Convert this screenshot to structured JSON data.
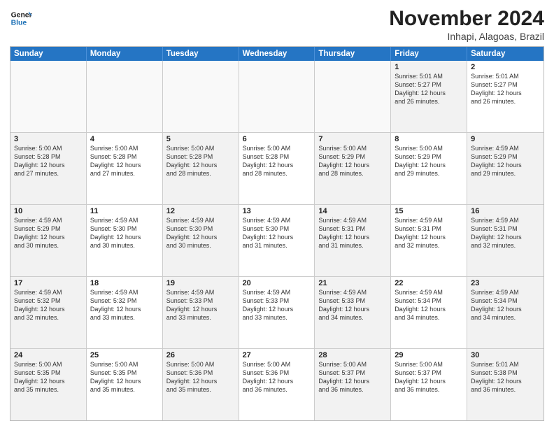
{
  "logo": {
    "text_general": "General",
    "text_blue": "Blue"
  },
  "title": "November 2024",
  "subtitle": "Inhapi, Alagoas, Brazil",
  "header_days": [
    "Sunday",
    "Monday",
    "Tuesday",
    "Wednesday",
    "Thursday",
    "Friday",
    "Saturday"
  ],
  "rows": [
    [
      {
        "day": "",
        "text": "",
        "empty": true
      },
      {
        "day": "",
        "text": "",
        "empty": true
      },
      {
        "day": "",
        "text": "",
        "empty": true
      },
      {
        "day": "",
        "text": "",
        "empty": true
      },
      {
        "day": "",
        "text": "",
        "empty": true
      },
      {
        "day": "1",
        "text": "Sunrise: 5:01 AM\nSunset: 5:27 PM\nDaylight: 12 hours\nand 26 minutes.",
        "empty": false,
        "shaded": true
      },
      {
        "day": "2",
        "text": "Sunrise: 5:01 AM\nSunset: 5:27 PM\nDaylight: 12 hours\nand 26 minutes.",
        "empty": false,
        "shaded": false
      }
    ],
    [
      {
        "day": "3",
        "text": "Sunrise: 5:00 AM\nSunset: 5:28 PM\nDaylight: 12 hours\nand 27 minutes.",
        "empty": false,
        "shaded": true
      },
      {
        "day": "4",
        "text": "Sunrise: 5:00 AM\nSunset: 5:28 PM\nDaylight: 12 hours\nand 27 minutes.",
        "empty": false,
        "shaded": false
      },
      {
        "day": "5",
        "text": "Sunrise: 5:00 AM\nSunset: 5:28 PM\nDaylight: 12 hours\nand 28 minutes.",
        "empty": false,
        "shaded": true
      },
      {
        "day": "6",
        "text": "Sunrise: 5:00 AM\nSunset: 5:28 PM\nDaylight: 12 hours\nand 28 minutes.",
        "empty": false,
        "shaded": false
      },
      {
        "day": "7",
        "text": "Sunrise: 5:00 AM\nSunset: 5:29 PM\nDaylight: 12 hours\nand 28 minutes.",
        "empty": false,
        "shaded": true
      },
      {
        "day": "8",
        "text": "Sunrise: 5:00 AM\nSunset: 5:29 PM\nDaylight: 12 hours\nand 29 minutes.",
        "empty": false,
        "shaded": false
      },
      {
        "day": "9",
        "text": "Sunrise: 4:59 AM\nSunset: 5:29 PM\nDaylight: 12 hours\nand 29 minutes.",
        "empty": false,
        "shaded": true
      }
    ],
    [
      {
        "day": "10",
        "text": "Sunrise: 4:59 AM\nSunset: 5:29 PM\nDaylight: 12 hours\nand 30 minutes.",
        "empty": false,
        "shaded": true
      },
      {
        "day": "11",
        "text": "Sunrise: 4:59 AM\nSunset: 5:30 PM\nDaylight: 12 hours\nand 30 minutes.",
        "empty": false,
        "shaded": false
      },
      {
        "day": "12",
        "text": "Sunrise: 4:59 AM\nSunset: 5:30 PM\nDaylight: 12 hours\nand 30 minutes.",
        "empty": false,
        "shaded": true
      },
      {
        "day": "13",
        "text": "Sunrise: 4:59 AM\nSunset: 5:30 PM\nDaylight: 12 hours\nand 31 minutes.",
        "empty": false,
        "shaded": false
      },
      {
        "day": "14",
        "text": "Sunrise: 4:59 AM\nSunset: 5:31 PM\nDaylight: 12 hours\nand 31 minutes.",
        "empty": false,
        "shaded": true
      },
      {
        "day": "15",
        "text": "Sunrise: 4:59 AM\nSunset: 5:31 PM\nDaylight: 12 hours\nand 32 minutes.",
        "empty": false,
        "shaded": false
      },
      {
        "day": "16",
        "text": "Sunrise: 4:59 AM\nSunset: 5:31 PM\nDaylight: 12 hours\nand 32 minutes.",
        "empty": false,
        "shaded": true
      }
    ],
    [
      {
        "day": "17",
        "text": "Sunrise: 4:59 AM\nSunset: 5:32 PM\nDaylight: 12 hours\nand 32 minutes.",
        "empty": false,
        "shaded": true
      },
      {
        "day": "18",
        "text": "Sunrise: 4:59 AM\nSunset: 5:32 PM\nDaylight: 12 hours\nand 33 minutes.",
        "empty": false,
        "shaded": false
      },
      {
        "day": "19",
        "text": "Sunrise: 4:59 AM\nSunset: 5:33 PM\nDaylight: 12 hours\nand 33 minutes.",
        "empty": false,
        "shaded": true
      },
      {
        "day": "20",
        "text": "Sunrise: 4:59 AM\nSunset: 5:33 PM\nDaylight: 12 hours\nand 33 minutes.",
        "empty": false,
        "shaded": false
      },
      {
        "day": "21",
        "text": "Sunrise: 4:59 AM\nSunset: 5:33 PM\nDaylight: 12 hours\nand 34 minutes.",
        "empty": false,
        "shaded": true
      },
      {
        "day": "22",
        "text": "Sunrise: 4:59 AM\nSunset: 5:34 PM\nDaylight: 12 hours\nand 34 minutes.",
        "empty": false,
        "shaded": false
      },
      {
        "day": "23",
        "text": "Sunrise: 4:59 AM\nSunset: 5:34 PM\nDaylight: 12 hours\nand 34 minutes.",
        "empty": false,
        "shaded": true
      }
    ],
    [
      {
        "day": "24",
        "text": "Sunrise: 5:00 AM\nSunset: 5:35 PM\nDaylight: 12 hours\nand 35 minutes.",
        "empty": false,
        "shaded": true
      },
      {
        "day": "25",
        "text": "Sunrise: 5:00 AM\nSunset: 5:35 PM\nDaylight: 12 hours\nand 35 minutes.",
        "empty": false,
        "shaded": false
      },
      {
        "day": "26",
        "text": "Sunrise: 5:00 AM\nSunset: 5:36 PM\nDaylight: 12 hours\nand 35 minutes.",
        "empty": false,
        "shaded": true
      },
      {
        "day": "27",
        "text": "Sunrise: 5:00 AM\nSunset: 5:36 PM\nDaylight: 12 hours\nand 36 minutes.",
        "empty": false,
        "shaded": false
      },
      {
        "day": "28",
        "text": "Sunrise: 5:00 AM\nSunset: 5:37 PM\nDaylight: 12 hours\nand 36 minutes.",
        "empty": false,
        "shaded": true
      },
      {
        "day": "29",
        "text": "Sunrise: 5:00 AM\nSunset: 5:37 PM\nDaylight: 12 hours\nand 36 minutes.",
        "empty": false,
        "shaded": false
      },
      {
        "day": "30",
        "text": "Sunrise: 5:01 AM\nSunset: 5:38 PM\nDaylight: 12 hours\nand 36 minutes.",
        "empty": false,
        "shaded": true
      }
    ]
  ]
}
